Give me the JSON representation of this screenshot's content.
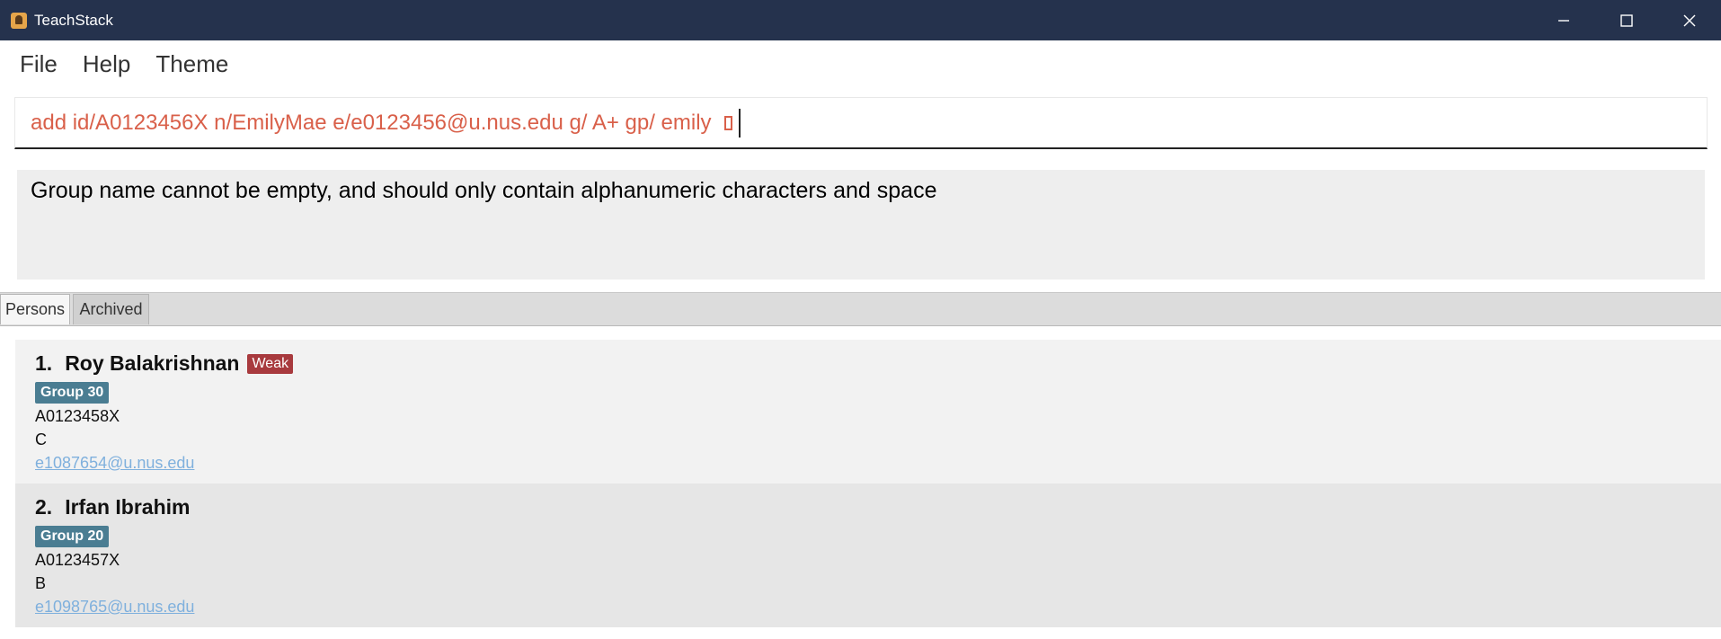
{
  "window": {
    "title": "TeachStack",
    "controls": [
      "minimize-icon",
      "maximize-icon",
      "close-icon"
    ]
  },
  "menu": {
    "items": [
      "File",
      "Help",
      "Theme"
    ]
  },
  "command": {
    "value": "add id/A0123456X n/EmilyMae e/e0123456@u.nus.edu g/ A+ gp/ emily",
    "color": "#d9604a"
  },
  "result": {
    "message": "Group name cannot be empty, and should only contain alphanumeric characters and space"
  },
  "tabs": [
    {
      "label": "Persons",
      "active": true
    },
    {
      "label": "Archived",
      "active": false
    }
  ],
  "persons": [
    {
      "index": "1.",
      "name": "Roy Balakrishnan",
      "tag": "Weak",
      "group": "Group 30",
      "id": "A0123458X",
      "grade": "C",
      "email": "e1087654@u.nus.edu"
    },
    {
      "index": "2.",
      "name": "Irfan Ibrahim",
      "group": "Group 20",
      "id": "A0123457X",
      "grade": "B",
      "email": "e1098765@u.nus.edu"
    }
  ],
  "colors": {
    "titlebar": "#25324d",
    "weak_tag": "#a83a3e",
    "group_tag": "#4a7d92",
    "email_link": "#7fb0dd"
  }
}
